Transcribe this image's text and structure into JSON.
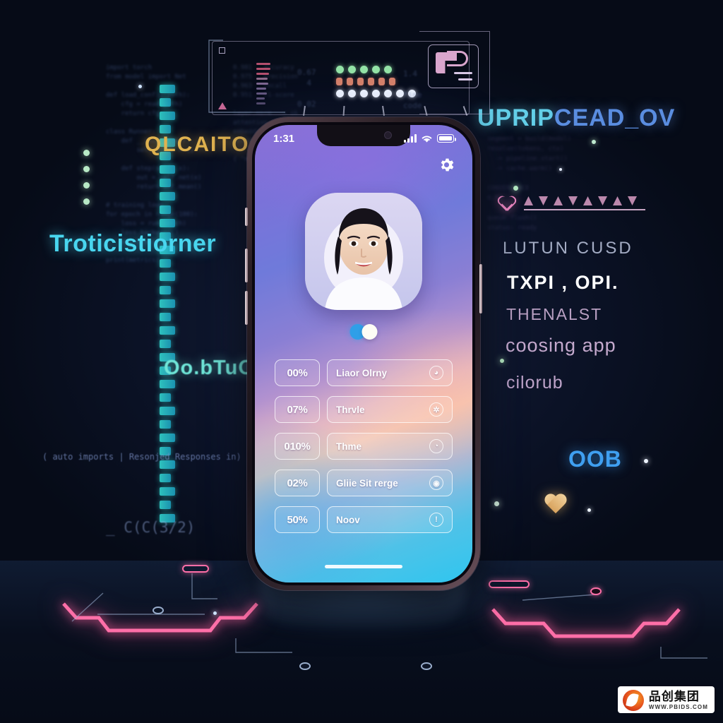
{
  "background": {
    "base_color": "#060b17",
    "left_code_block": "import torch\nfrom model import Net\n\ndef load_config(path):\n    cfg = read(path)\n    return cfg\n\nclass Runner:\n    def __init__(self):\n        self.state = {}\n\n    def step(self, x):\n        out = self.net(x)\n        return out.mean()\n\n# training loop\nfor epoch in range(100):\n    loss = run(batch)\n    loss.backward()\n    opt.step()\n\nprint(metrics)\n",
    "left_code_block_2": "0.981   accuracy\n0.975   precision\n0.963   recall\n0.951   f1-score\n\nlayer.norm  -> ok\nattention   -> ok\nembedding   -> ok\ndecoder     -> ok\n\n{ \"mode\": \"infer\" }\n",
    "right_code_block": "segment = build(model)\nresolve(tokens, ctx)\n  -> pipeline.start()\n  -> cache.warm()\n\nCONVERGENCE\n0.92\n\nqueue.flush()\nstatus: ready\n",
    "hud_ghost_1": "0.67\n  4\n\n0.02",
    "hud_ghost_2": "1.4\n\nfine\ncode",
    "hud_ghost_3": "224\n0.66"
  },
  "overlay_text": {
    "qlcaito": "QLCAITO",
    "troticistiorner": "Troticistiorner",
    "scrambled_teal": "Oo.bTuO",
    "paren_line": "( auto imports | Resonjed Responses in) | engulaxtte caplicuzdres) : 1",
    "bracket_line": "_ C(C(3/2)",
    "uprip_part_a": "UPRIP",
    "uprip_part_b": "CEAD_OV",
    "lutun_cusd": "LUTUN  CUSD",
    "txpi_opi": "TXPI , OPI.",
    "thenalst": "THENALST",
    "coosing_app": "coosing  app",
    "cilorub": "cilorub",
    "oob": "OOB"
  },
  "hud": {
    "panel_label": "telemetry-panel",
    "card_label": "device-card",
    "led_rows": [
      {
        "name": "green-leds",
        "count": 5
      },
      {
        "name": "orange-leds",
        "count": 6
      },
      {
        "name": "white-leds",
        "count": 7
      }
    ],
    "bar_count": 9
  },
  "phone": {
    "status_bar": {
      "time": "1:31",
      "signal_icon": "cellular-signal-icon",
      "wifi_icon": "wifi-icon",
      "battery_icon": "battery-full-icon"
    },
    "settings_icon": "gear-icon",
    "avatar": {
      "name": "user-avatar",
      "alt": "Portrait of a smiling young woman"
    },
    "page_dots": [
      {
        "state": "active",
        "color": "#2f9fe8"
      },
      {
        "state": "inactive",
        "color": "#fdfdf5"
      }
    ],
    "list": [
      {
        "percent": "00%",
        "label": "Liaor Olrny",
        "icon": "pie-chart-icon",
        "icon_glyph": "◕"
      },
      {
        "percent": "07%",
        "label": "Thrvle",
        "icon": "globe-icon",
        "icon_glyph": "✲"
      },
      {
        "percent": "010%",
        "label": "Thme",
        "icon": "cloud-icon",
        "icon_glyph": "◔"
      },
      {
        "percent": "02%",
        "label": "Gliie Sit rerge",
        "icon": "person-icon",
        "icon_glyph": "◉"
      },
      {
        "percent": "50%",
        "label": "Noov",
        "icon": "info-icon",
        "icon_glyph": "!"
      }
    ],
    "home_indicator": "home-indicator",
    "screen_gradient": [
      "#8a6fd6",
      "#b392cf",
      "#f3c9b8",
      "#2fc6ef"
    ]
  },
  "watermark": {
    "brand_cn": "品创集团",
    "url": "WWW.PBIDS.COM"
  },
  "accents": {
    "neon_pink": "#ff6fa8",
    "teal": "#35e0d8",
    "gold": "#e0b24f",
    "blue": "#3f9ff0"
  }
}
